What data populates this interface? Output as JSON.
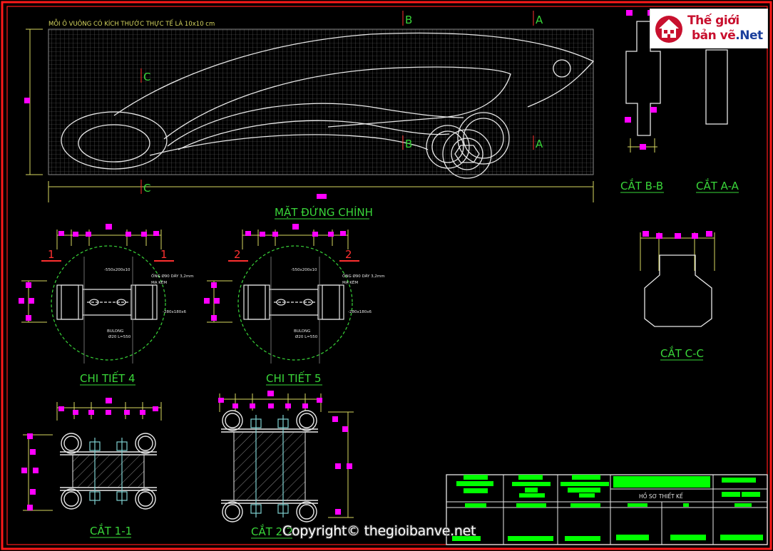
{
  "title_note": "MỖI Ô VUÔNG CÓ KÍCH THƯỚC THỰC TẾ LÀ 10x10 cm",
  "main_view": {
    "label": "MẶT ĐỨNG CHÍNH",
    "marker_a": "A",
    "marker_b": "B",
    "marker_c": "C"
  },
  "section_b": {
    "label": "CẮT B-B"
  },
  "section_a": {
    "label": "CẮT A-A"
  },
  "section_c": {
    "label": "CẮT C-C"
  },
  "detail4": {
    "label": "CHI TIẾT 4",
    "marker": "1",
    "plate": "-550x200x10",
    "pipe": "ỐNG Ø90 DÀY 3,2mm",
    "pipe_note": "MẠ KẼM",
    "side_plate": "-280x180x6",
    "bolt": "BULONG",
    "bolt_spec": "Ø20 L=550"
  },
  "detail5": {
    "label": "CHI TIẾT 5",
    "marker": "2",
    "plate": "-550x200x10",
    "pipe": "ỐNG Ø90 DÀY 3,2mm",
    "pipe_note": "MẠ KẼM",
    "side_plate": "-280x180x6",
    "bolt": "BULONG",
    "bolt_spec": "Ø20 L=550"
  },
  "section_1": {
    "label": "CẮT 1-1"
  },
  "section_2": {
    "label": "CẮT 2-2"
  },
  "title_block": {
    "heading": "HỒ SƠ THIẾT KẾ"
  },
  "logo": {
    "line1": "Thế giới",
    "line2a": "bản vẽ",
    "line2b": ".Net"
  },
  "watermark": "Copyright© thegioibanve.net",
  "colors": {
    "border": "#ff1a1a",
    "linework": "#e8e8e8",
    "labels": "#39d639",
    "dimensions": "#d8d860",
    "grips": "#ff00ff",
    "title_fill": "#00ff00"
  }
}
